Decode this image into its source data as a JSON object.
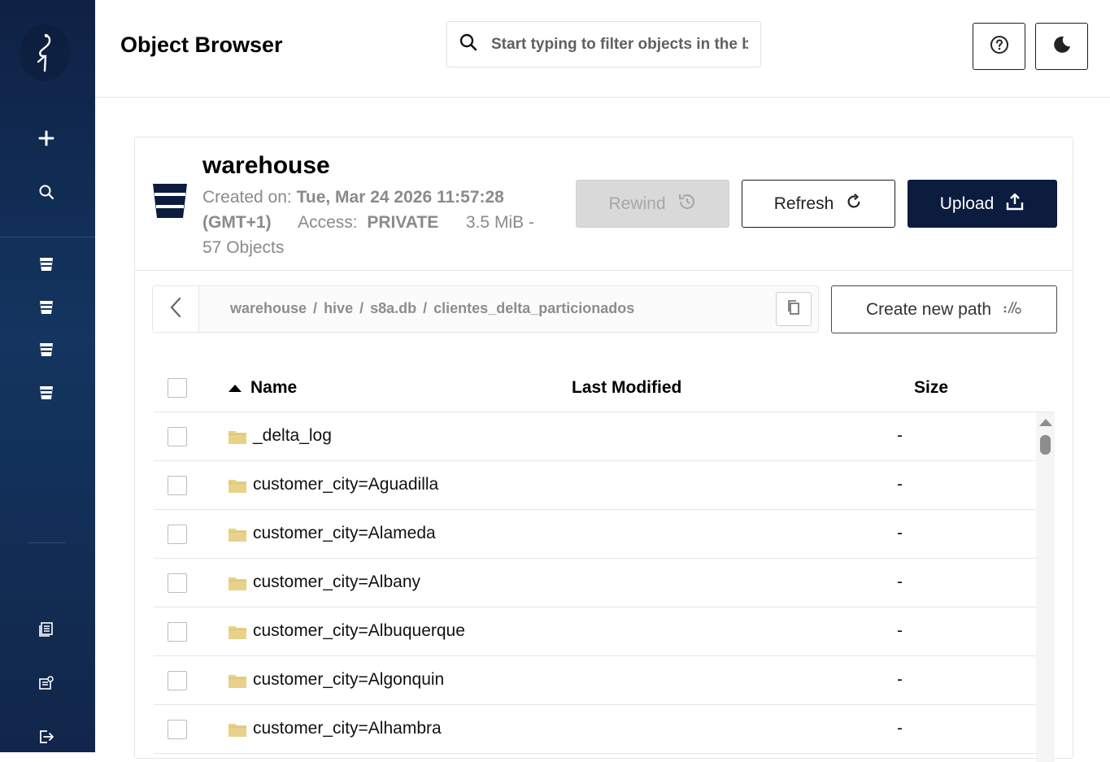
{
  "header": {
    "title": "Object Browser",
    "search_placeholder": "Start typing to filter objects in the bucket"
  },
  "bucket": {
    "name": "warehouse",
    "created_label": "Created on:",
    "created_value": "Tue, Mar 24 2026 11:57:28 (GMT+1)",
    "access_label": "Access:",
    "access_value": "PRIVATE",
    "size": "3.5 MiB",
    "separator": "-",
    "objects": "57 Objects"
  },
  "actions": {
    "rewind_label": "Rewind",
    "refresh_label": "Refresh",
    "upload_label": "Upload",
    "create_path_label": "Create new path"
  },
  "breadcrumb": {
    "parts": [
      "warehouse",
      "hive",
      "s8a.db",
      "clientes_delta_particionados"
    ],
    "separator": "/"
  },
  "table": {
    "columns": {
      "name": "Name",
      "last_modified": "Last Modified",
      "size": "Size"
    },
    "rows": [
      {
        "name": "_delta_log",
        "size": "-"
      },
      {
        "name": "customer_city=Aguadilla",
        "size": "-"
      },
      {
        "name": "customer_city=Alameda",
        "size": "-"
      },
      {
        "name": "customer_city=Albany",
        "size": "-"
      },
      {
        "name": "customer_city=Albuquerque",
        "size": "-"
      },
      {
        "name": "customer_city=Algonquin",
        "size": "-"
      },
      {
        "name": "customer_city=Alhambra",
        "size": "-"
      }
    ]
  },
  "colors": {
    "sidebar_bg": "#13355f",
    "primary": "#0b1c3f",
    "folder": "#e8d28a",
    "muted_text": "#8a8a8a"
  },
  "icons": {
    "sidebar_top": [
      "logo-icon",
      "plus-icon",
      "search-icon"
    ],
    "sidebar_buckets": [
      "bucket-icon",
      "bucket-icon",
      "bucket-icon",
      "bucket-icon"
    ],
    "sidebar_bottom": [
      "documentation-icon",
      "license-icon",
      "logout-icon"
    ]
  }
}
